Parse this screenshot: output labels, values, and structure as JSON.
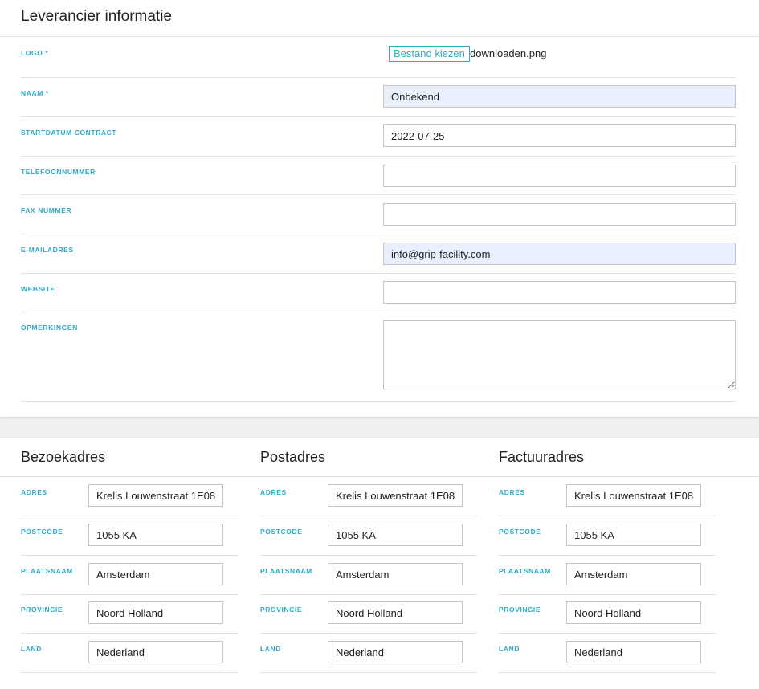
{
  "supplier": {
    "title": "Leverancier informatie",
    "logo": {
      "label": "LOGO *",
      "button_label": "Bestand kiezen",
      "file_name": "downloaden.png"
    },
    "fields": {
      "naam": {
        "label": "NAAM *",
        "value": "Onbekend"
      },
      "startdatum": {
        "label": "STARTDATUM CONTRACT",
        "value": "2022-07-25"
      },
      "telefoon": {
        "label": "TELEFOONNUMMER",
        "value": ""
      },
      "fax": {
        "label": "FAX NUMMER",
        "value": ""
      },
      "email": {
        "label": "E-MAILADRES",
        "value": "info@grip-facility.com"
      },
      "website": {
        "label": "WEBSITE",
        "value": ""
      },
      "opmerkingen": {
        "label": "OPMERKINGEN",
        "value": ""
      }
    }
  },
  "addresses": {
    "labels": {
      "adres": "ADRES",
      "postcode": "POSTCODE",
      "plaatsnaam": "PLAATSNAAM",
      "provincie": "PROVINCIE",
      "land": "LAND"
    },
    "bezoek": {
      "title": "Bezoekadres",
      "adres": "Krelis Louwenstraat 1E08",
      "postcode": "1055 KA",
      "plaatsnaam": "Amsterdam",
      "provincie": "Noord Holland",
      "land": "Nederland"
    },
    "post": {
      "title": "Postadres",
      "adres": "Krelis Louwenstraat 1E08",
      "postcode": "1055 KA",
      "plaatsnaam": "Amsterdam",
      "provincie": "Noord Holland",
      "land": "Nederland"
    },
    "factuur": {
      "title": "Factuuradres",
      "adres": "Krelis Louwenstraat 1E08",
      "postcode": "1055 KA",
      "plaatsnaam": "Amsterdam",
      "provincie": "Noord Holland",
      "land": "Nederland"
    }
  },
  "colors": {
    "label": "#31a9c9",
    "autofill_bg": "#e8f0fe",
    "border": "#c4c4c4",
    "divider": "#e2e2e2"
  }
}
